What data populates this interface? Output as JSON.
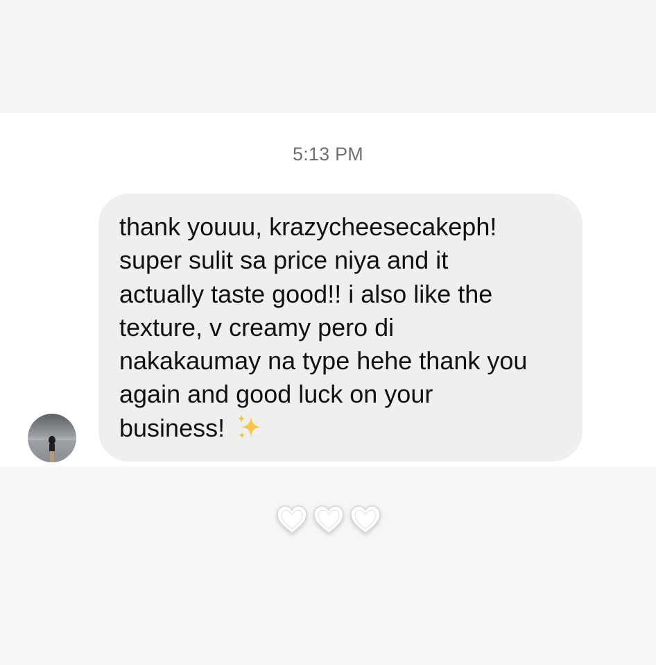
{
  "conversation": {
    "timestamp": "5:13 PM",
    "message": {
      "lines": [
        "thank youuu, krazycheesecakeph!",
        "super sulit sa price niya and it",
        "actually taste good!! i also like the",
        "texture, v creamy pero di",
        "nakakaumay na type hehe thank you",
        "again and good luck on your",
        "business!"
      ],
      "emoji": "sparkles-emoji"
    },
    "sender": {
      "avatar_icon": "profile-avatar"
    },
    "reactions": {
      "icons": [
        "heart-icon",
        "heart-icon",
        "heart-icon"
      ],
      "color": "#ffffff"
    }
  },
  "colors": {
    "bubble": "#efefef",
    "timestamp": "#6f6f6f",
    "text": "#111111",
    "sparkle": "#f6c84a"
  }
}
